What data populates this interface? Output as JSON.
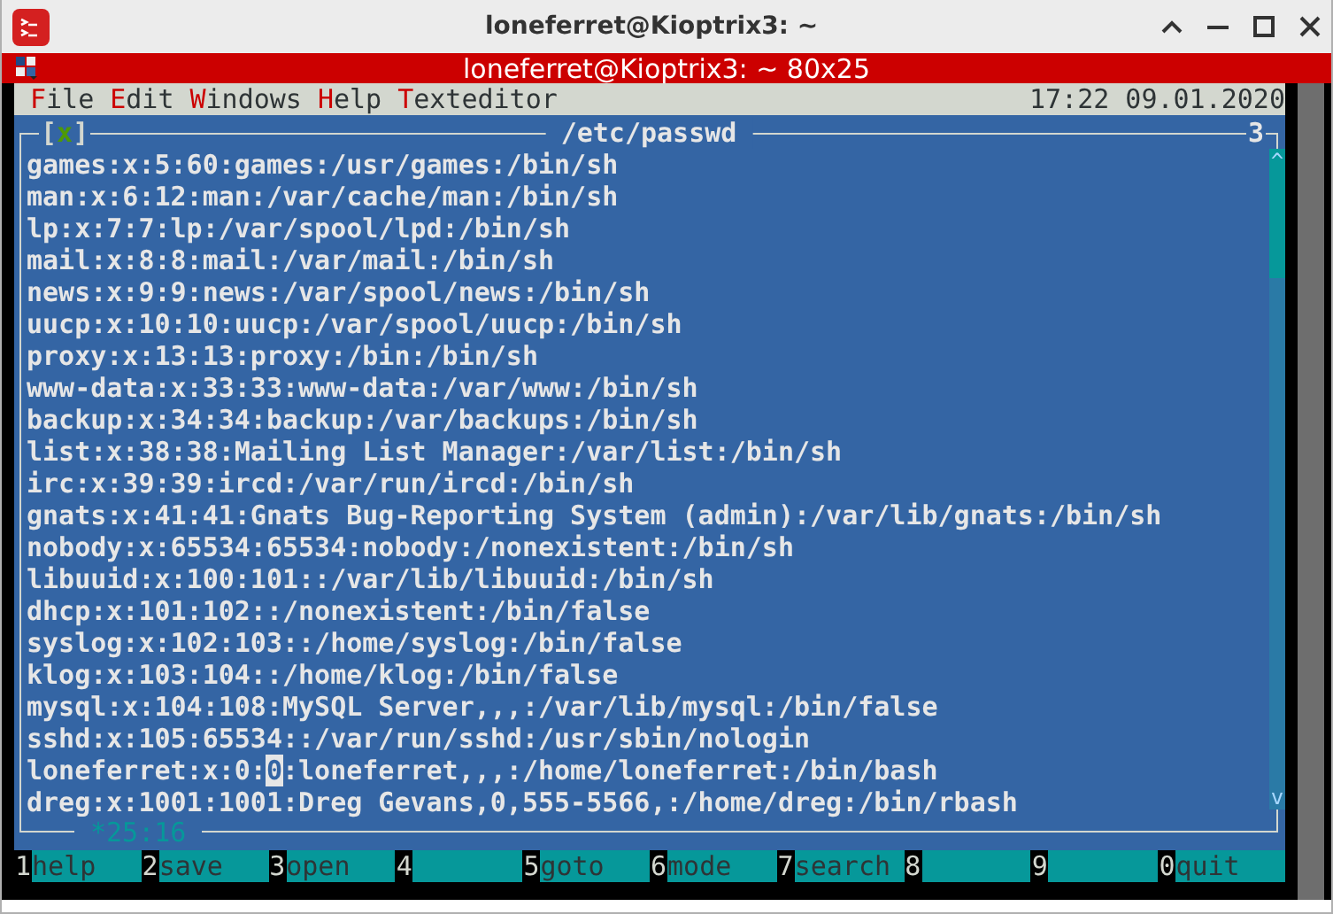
{
  "window": {
    "title": "loneferret@Kioptrix3: ~"
  },
  "terminal": {
    "title": "loneferret@Kioptrix3: ~ 80x25"
  },
  "menu": [
    {
      "key": "F",
      "rest": "ile"
    },
    {
      "key": "E",
      "rest": "dit"
    },
    {
      "key": "W",
      "rest": "indows"
    },
    {
      "key": "H",
      "rest": "elp"
    },
    {
      "key": "T",
      "rest": "exteditor"
    }
  ],
  "clock": "17:22 09.01.2020",
  "editor": {
    "close_box": {
      "open": "[",
      "mark": "x",
      "close": "]"
    },
    "title": "/etc/passwd",
    "window_number": "3",
    "position": "*25:16",
    "scrollbar": {
      "up": "^",
      "down": "v"
    },
    "lines": [
      {
        "text": "games:x:5:60:games:/usr/games:/bin/sh"
      },
      {
        "text": "man:x:6:12:man:/var/cache/man:/bin/sh"
      },
      {
        "text": "lp:x:7:7:lp:/var/spool/lpd:/bin/sh"
      },
      {
        "text": "mail:x:8:8:mail:/var/mail:/bin/sh"
      },
      {
        "text": "news:x:9:9:news:/var/spool/news:/bin/sh"
      },
      {
        "text": "uucp:x:10:10:uucp:/var/spool/uucp:/bin/sh"
      },
      {
        "text": "proxy:x:13:13:proxy:/bin:/bin/sh"
      },
      {
        "text": "www-data:x:33:33:www-data:/var/www:/bin/sh"
      },
      {
        "text": "backup:x:34:34:backup:/var/backups:/bin/sh"
      },
      {
        "text": "list:x:38:38:Mailing List Manager:/var/list:/bin/sh"
      },
      {
        "text": "irc:x:39:39:ircd:/var/run/ircd:/bin/sh"
      },
      {
        "text": "gnats:x:41:41:Gnats Bug-Reporting System (admin):/var/lib/gnats:/bin/sh"
      },
      {
        "text": "nobody:x:65534:65534:nobody:/nonexistent:/bin/sh"
      },
      {
        "text": "libuuid:x:100:101::/var/lib/libuuid:/bin/sh"
      },
      {
        "text": "dhcp:x:101:102::/nonexistent:/bin/false"
      },
      {
        "text": "syslog:x:102:103::/home/syslog:/bin/false"
      },
      {
        "text": "klog:x:103:104::/home/klog:/bin/false"
      },
      {
        "text": "mysql:x:104:108:MySQL Server,,,:/var/lib/mysql:/bin/false"
      },
      {
        "text": "sshd:x:105:65534::/var/run/sshd:/usr/sbin/nologin"
      },
      {
        "text": "loneferret:x:0:",
        "cursor": "0",
        "after": ":loneferret,,,:/home/loneferret:/bin/bash"
      },
      {
        "text": "dreg:x:1001:1001:Dreg Gevans,0,555-5566,:/home/dreg:/bin/rbash"
      }
    ]
  },
  "function_keys": [
    {
      "key": "1",
      "label": "help"
    },
    {
      "key": "2",
      "label": "save"
    },
    {
      "key": "3",
      "label": "open"
    },
    {
      "key": "4"
    },
    {
      "key": "5",
      "label": "goto"
    },
    {
      "key": "6",
      "label": "mode"
    },
    {
      "key": "7",
      "label": "search"
    },
    {
      "key": "8"
    },
    {
      "key": "9"
    },
    {
      "key": "0",
      "label": "quit"
    }
  ]
}
